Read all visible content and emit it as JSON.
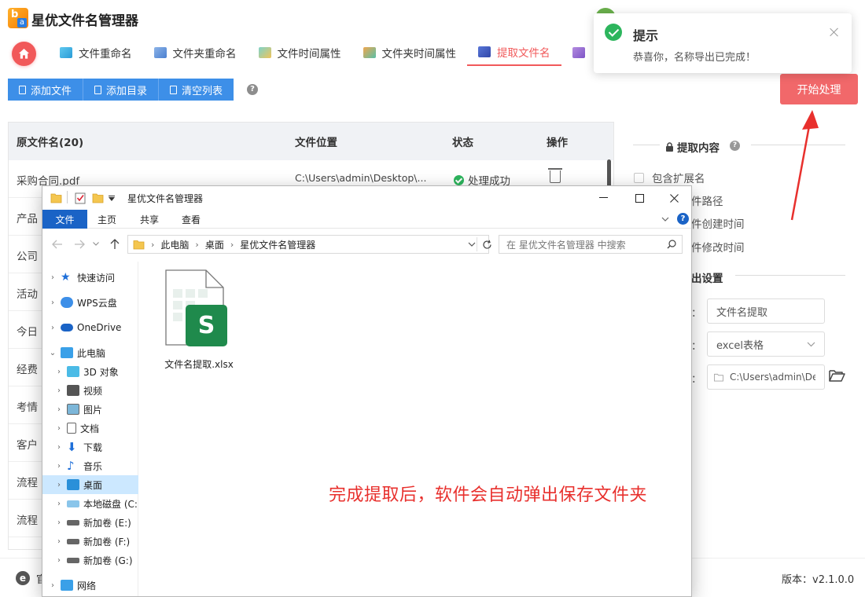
{
  "app": {
    "title": "星优文件名管理器",
    "logo_letter_b": "b",
    "logo_letter_a": "a"
  },
  "nav": {
    "tabs": [
      {
        "label": "文件重命名",
        "icon": "rename-icon"
      },
      {
        "label": "文件夹重命名",
        "icon": "folder-rename-icon"
      },
      {
        "label": "文件时间属性",
        "icon": "file-time-icon"
      },
      {
        "label": "文件夹时间属性",
        "icon": "folder-time-icon"
      },
      {
        "label": "提取文件名",
        "icon": "extract-icon",
        "active": true
      }
    ]
  },
  "toolbar": {
    "add_file": "添加文件",
    "add_dir": "添加目录",
    "clear_list": "清空列表",
    "help": "?"
  },
  "start_button": "开始处理",
  "table": {
    "headers": {
      "name": "原文件名(20)",
      "location": "文件位置",
      "status": "状态",
      "action": "操作"
    },
    "rows": [
      {
        "name": "采购合同.pdf",
        "location": "C:\\Users\\admin\\Desktop\\...",
        "status": "处理成功"
      },
      {
        "name": "产品",
        "location": "",
        "status": ""
      },
      {
        "name": "公司",
        "location": "",
        "status": ""
      },
      {
        "name": "活动",
        "location": "",
        "status": ""
      },
      {
        "name": "今日",
        "location": "",
        "status": ""
      },
      {
        "name": "经费",
        "location": "",
        "status": ""
      },
      {
        "name": "考情",
        "location": "",
        "status": ""
      },
      {
        "name": "客户",
        "location": "",
        "status": ""
      },
      {
        "name": "流程",
        "location": "",
        "status": ""
      },
      {
        "name": "流程",
        "location": "",
        "status": ""
      }
    ]
  },
  "right_panel": {
    "extract_title": "提取内容",
    "help": "?",
    "options": [
      {
        "label": "包含扩展名",
        "checked": false
      },
      {
        "label": "件路径",
        "checked": false
      },
      {
        "label": "件创建时间",
        "checked": false
      },
      {
        "label": "件修改时间",
        "checked": false
      }
    ],
    "export_title": "出设置",
    "fields": [
      {
        "label": "：",
        "value": "文件名提取"
      },
      {
        "label": "：",
        "value": "excel表格"
      },
      {
        "label": "：",
        "value": "C:\\Users\\admin\\Des"
      }
    ]
  },
  "bottom": {
    "partial_text": "官",
    "version": "版本：v2.1.0.0"
  },
  "toast": {
    "title": "提示",
    "message": "恭喜你，名称导出已完成！"
  },
  "explorer": {
    "title": "星优文件名管理器",
    "ribbon": [
      "文件",
      "主页",
      "共享",
      "查看"
    ],
    "breadcrumb": [
      "此电脑",
      "桌面",
      "星优文件名管理器"
    ],
    "search_placeholder": "在 星优文件名管理器 中搜索",
    "nav_items": [
      {
        "label": "快速访问",
        "icon": "star-icon",
        "level": 0
      },
      {
        "label": "WPS云盘",
        "icon": "cloud-icon",
        "level": 0
      },
      {
        "label": "OneDrive",
        "icon": "onedrive-icon",
        "level": 0
      },
      {
        "label": "此电脑",
        "icon": "computer-icon",
        "level": 0,
        "expanded": true
      },
      {
        "label": "3D 对象",
        "icon": "cube-icon",
        "level": 1
      },
      {
        "label": "视频",
        "icon": "video-icon",
        "level": 1
      },
      {
        "label": "图片",
        "icon": "image-icon",
        "level": 1
      },
      {
        "label": "文档",
        "icon": "document-icon",
        "level": 1
      },
      {
        "label": "下载",
        "icon": "download-icon",
        "level": 1
      },
      {
        "label": "音乐",
        "icon": "music-icon",
        "level": 1
      },
      {
        "label": "桌面",
        "icon": "desktop-icon",
        "level": 1,
        "selected": true
      },
      {
        "label": "本地磁盘 (C:",
        "icon": "disk-icon",
        "level": 1
      },
      {
        "label": "新加卷 (E:)",
        "icon": "drive-icon",
        "level": 1
      },
      {
        "label": "新加卷 (F:)",
        "icon": "drive-icon",
        "level": 1
      },
      {
        "label": "新加卷 (G:)",
        "icon": "drive-icon",
        "level": 1
      },
      {
        "label": "网络",
        "icon": "network-icon",
        "level": 0
      }
    ],
    "file": {
      "name": "文件名提取.xlsx",
      "badge": "S"
    },
    "caption": "完成提取后，软件会自动弹出保存文件夹"
  },
  "colors": {
    "accent": "#f1595a",
    "toolbar_blue": "#3d8fe8",
    "success": "#2db55d",
    "caption_red": "#e8302d",
    "excel_green": "#1f8a4c"
  }
}
